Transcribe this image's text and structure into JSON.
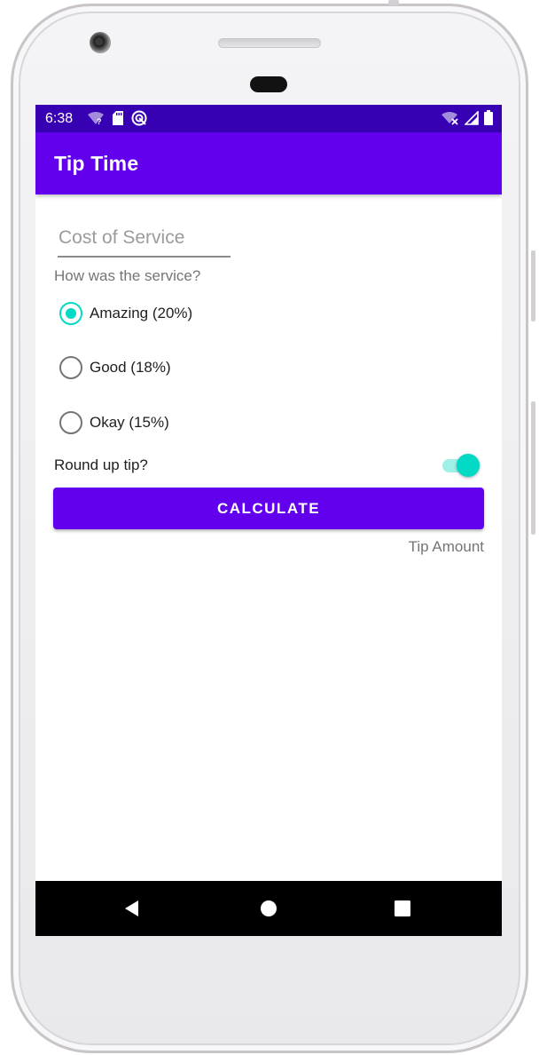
{
  "status_bar": {
    "time": "6:38",
    "icons_left": [
      "wifi-question-icon",
      "sd-card-icon",
      "sync-icon"
    ],
    "icons_right": [
      "wifi-off-icon",
      "cell-signal-icon",
      "battery-icon"
    ]
  },
  "app_bar": {
    "title": "Tip Time"
  },
  "form": {
    "cost_placeholder": "Cost of Service",
    "cost_value": "",
    "question": "How was the service?",
    "options": [
      {
        "label": "Amazing (20%)",
        "checked": true
      },
      {
        "label": "Good (18%)",
        "checked": false
      },
      {
        "label": "Okay (15%)",
        "checked": false
      }
    ],
    "round_up_label": "Round up tip?",
    "round_up_on": true,
    "calculate_label": "CALCULATE",
    "tip_amount": "Tip Amount"
  },
  "nav_bar": {
    "buttons": [
      "back-icon",
      "home-icon",
      "recents-icon"
    ]
  },
  "colors": {
    "primary": "#6200ee",
    "primary_dark": "#3700b3",
    "accent": "#03dac5"
  }
}
